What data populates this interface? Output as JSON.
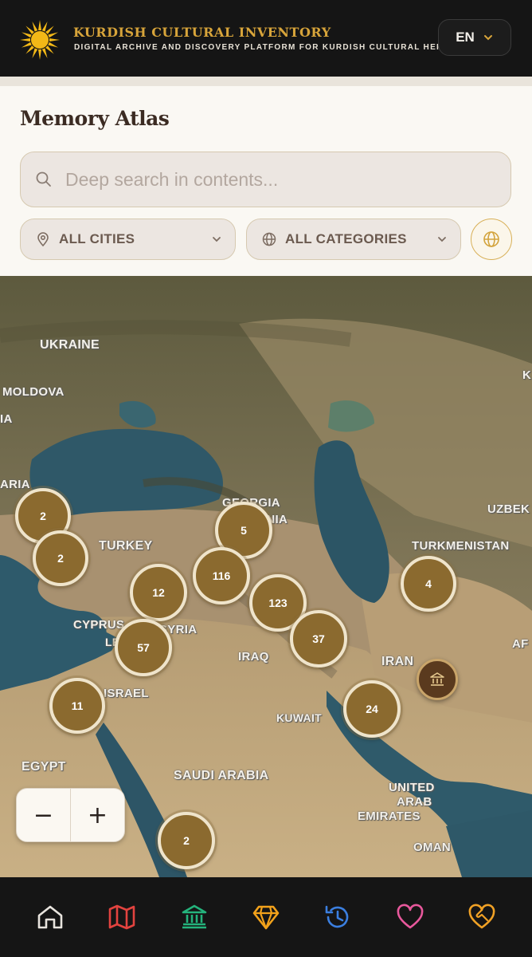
{
  "header": {
    "title": "KURDISH CULTURAL INVENTORY",
    "subtitle": "DIGITAL ARCHIVE AND DISCOVERY PLATFORM FOR KURDISH CULTURAL HERITAGE",
    "language": "EN",
    "logo_icon": "sun-logo-icon"
  },
  "page": {
    "title": "Memory Atlas"
  },
  "search": {
    "placeholder": "Deep search in contents...",
    "value": ""
  },
  "filters": {
    "city": "ALL CITIES",
    "category": "ALL CATEGORIES"
  },
  "map": {
    "countries": [
      "UKRAINE",
      "MOLDOVA",
      "IA",
      "ARIA",
      "GEORGIA",
      "ARMENIA",
      "TURKEY",
      "CYPRUS",
      "LEBANON",
      "SYRIA",
      "IRAQ",
      "ISRAEL",
      "KUWAIT",
      "IRAN",
      "TURKMENISTAN",
      "UZBEK",
      "AF",
      "EGYPT",
      "SAUDI ARABIA",
      "UNITED",
      "ARAB",
      "EMIRATES",
      "OMAN",
      "K"
    ],
    "clusters": [
      "2",
      "2",
      "5",
      "116",
      "12",
      "123",
      "4",
      "37",
      "57",
      "11",
      "24",
      "2"
    ],
    "zoom_out": "−",
    "zoom_in": "+"
  },
  "nav": {
    "items": [
      "home-icon",
      "map-icon",
      "museum-icon",
      "gem-icon",
      "history-icon",
      "heart-icon",
      "heart-handshake-icon"
    ]
  },
  "colors": {
    "accent_gold": "#d7a43a",
    "cluster_fill": "#8b6a2f",
    "panel_bg": "#faf8f3",
    "header_bg": "#151515"
  }
}
